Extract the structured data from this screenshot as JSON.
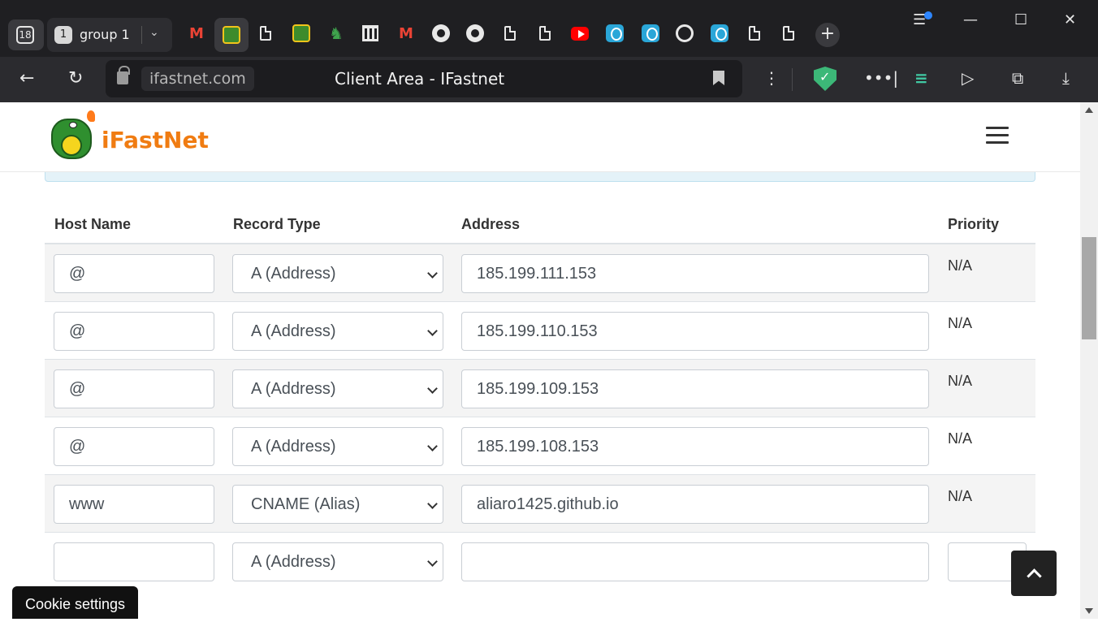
{
  "browser": {
    "tab_count": "18",
    "group": {
      "number": "1",
      "label": "group 1"
    },
    "address": {
      "domain": "ifastnet.com",
      "page_title": "Client Area - IFastnet"
    },
    "tab_icons": [
      "gmail-icon",
      "ifastnet-favicon",
      "document-icon",
      "ifastnet-favicon",
      "horse-icon",
      "museum-icon",
      "gmail-icon",
      "github-icon",
      "github-icon",
      "document-icon",
      "document-icon",
      "youtube-icon",
      "location-pin-icon",
      "location-pin-icon",
      "chatgpt-icon",
      "location-pin-icon",
      "document-icon",
      "document-icon"
    ],
    "colors": {
      "chrome_dark": "#1f1f22",
      "toolbar": "#2b2b2f",
      "shield": "#3cb878"
    }
  },
  "site": {
    "brand": "iFastNet",
    "brand_color": "#f07c12"
  },
  "dns_table": {
    "headers": {
      "host": "Host Name",
      "type": "Record Type",
      "address": "Address",
      "priority": "Priority"
    },
    "rows": [
      {
        "host": "@",
        "type": "A (Address)",
        "address": "185.199.111.153",
        "priority": "N/A"
      },
      {
        "host": "@",
        "type": "A (Address)",
        "address": "185.199.110.153",
        "priority": "N/A"
      },
      {
        "host": "@",
        "type": "A (Address)",
        "address": "185.199.109.153",
        "priority": "N/A"
      },
      {
        "host": "@",
        "type": "A (Address)",
        "address": "185.199.108.153",
        "priority": "N/A"
      },
      {
        "host": "www",
        "type": "CNAME (Alias)",
        "address": "aliaro1425.github.io",
        "priority": "N/A"
      },
      {
        "host": "",
        "type": "A (Address)",
        "address": "",
        "priority": ""
      }
    ]
  },
  "cookie_button": "Cookie settings"
}
